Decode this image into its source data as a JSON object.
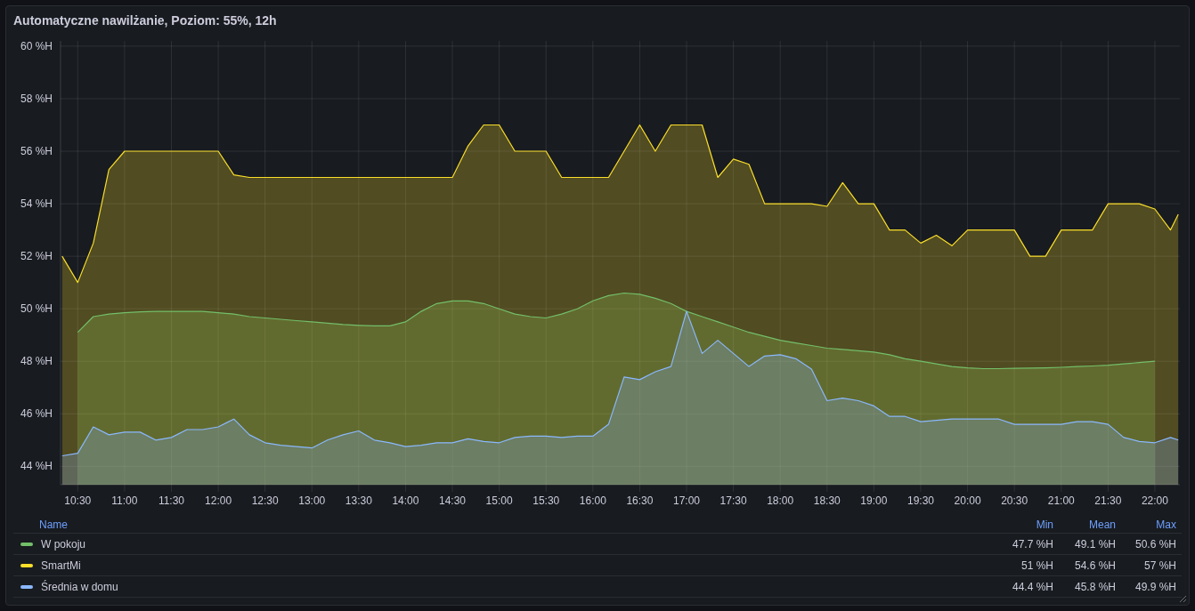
{
  "panel": {
    "title": "Automatyczne nawilżanie, Poziom: 55%, 12h",
    "chart_data": {
      "type": "area",
      "x": [
        620,
        630,
        640,
        650,
        660,
        670,
        680,
        690,
        700,
        710,
        720,
        730,
        740,
        750,
        760,
        770,
        780,
        790,
        800,
        810,
        820,
        830,
        840,
        850,
        860,
        870,
        880,
        890,
        900,
        910,
        920,
        930,
        940,
        950,
        960,
        970,
        980,
        990,
        1000,
        1010,
        1020,
        1030,
        1040,
        1050,
        1060,
        1070,
        1080,
        1090,
        1100,
        1110,
        1120,
        1130,
        1140,
        1150,
        1160,
        1170,
        1180,
        1190,
        1200,
        1210,
        1220,
        1230,
        1240,
        1250,
        1260,
        1270,
        1280,
        1290,
        1300,
        1310,
        1320,
        1330,
        1335
      ],
      "series": [
        {
          "name": "W pokoju",
          "color": "#73bf69",
          "values": [
            null,
            49.1,
            49.7,
            49.8,
            49.85,
            49.88,
            49.9,
            49.9,
            49.9,
            49.9,
            49.85,
            49.8,
            49.7,
            49.65,
            49.6,
            49.55,
            49.5,
            49.45,
            49.4,
            49.37,
            49.35,
            49.35,
            49.5,
            49.9,
            50.2,
            50.3,
            50.3,
            50.2,
            50.0,
            49.8,
            49.7,
            49.65,
            49.8,
            50.0,
            50.3,
            50.5,
            50.6,
            50.55,
            50.4,
            50.2,
            49.9,
            49.7,
            49.5,
            49.3,
            49.1,
            48.95,
            48.8,
            48.7,
            48.6,
            48.5,
            48.45,
            48.4,
            48.35,
            48.25,
            48.1,
            48.0,
            47.9,
            47.8,
            47.75,
            47.72,
            47.72,
            47.73,
            47.74,
            47.75,
            47.77,
            47.8,
            47.82,
            47.85,
            47.9,
            47.95,
            48.0,
            null,
            null
          ]
        },
        {
          "name": "SmartMi",
          "color": "#fade2a",
          "values": [
            52.0,
            51.0,
            52.5,
            55.3,
            56,
            56,
            56,
            56,
            56,
            56,
            56,
            55.1,
            55,
            55,
            55,
            55,
            55,
            55,
            55,
            55,
            55,
            55,
            55,
            55,
            55,
            55,
            56.2,
            57,
            57,
            56,
            56,
            56,
            55,
            55,
            55,
            55,
            56,
            57,
            56,
            57,
            57,
            57,
            55,
            55.7,
            55.5,
            54,
            54,
            54,
            54,
            53.9,
            54.8,
            54,
            54,
            53,
            53,
            52.5,
            52.8,
            52.4,
            53,
            53,
            53,
            53,
            52,
            52,
            53,
            53,
            53,
            54,
            54,
            54,
            53.8,
            53,
            53.6
          ]
        },
        {
          "name": "Średnia w domu",
          "color": "#8ab8ff",
          "values": [
            44.4,
            44.5,
            45.5,
            45.2,
            45.3,
            45.3,
            45.0,
            45.1,
            45.4,
            45.4,
            45.5,
            45.8,
            45.2,
            44.9,
            44.8,
            44.75,
            44.7,
            45.0,
            45.2,
            45.35,
            45.0,
            44.9,
            44.75,
            44.8,
            44.9,
            44.9,
            45.05,
            44.95,
            44.9,
            45.1,
            45.15,
            45.15,
            45.1,
            45.15,
            45.15,
            45.6,
            47.4,
            47.3,
            47.6,
            47.8,
            49.9,
            48.3,
            48.8,
            48.3,
            47.8,
            48.2,
            48.25,
            48.1,
            47.7,
            46.5,
            46.6,
            46.5,
            46.3,
            45.9,
            45.9,
            45.7,
            45.75,
            45.8,
            45.8,
            45.8,
            45.8,
            45.6,
            45.6,
            45.6,
            45.6,
            45.7,
            45.7,
            45.6,
            45.1,
            44.95,
            44.9,
            45.1,
            45.0
          ]
        }
      ],
      "grid": true,
      "xlim": [
        619,
        1336
      ],
      "ylim": [
        43.3,
        60.2
      ],
      "xticks": [
        {
          "value": 630,
          "label": "10:30"
        },
        {
          "value": 660,
          "label": "11:00"
        },
        {
          "value": 690,
          "label": "11:30"
        },
        {
          "value": 720,
          "label": "12:00"
        },
        {
          "value": 750,
          "label": "12:30"
        },
        {
          "value": 780,
          "label": "13:00"
        },
        {
          "value": 810,
          "label": "13:30"
        },
        {
          "value": 840,
          "label": "14:00"
        },
        {
          "value": 870,
          "label": "14:30"
        },
        {
          "value": 900,
          "label": "15:00"
        },
        {
          "value": 930,
          "label": "15:30"
        },
        {
          "value": 960,
          "label": "16:00"
        },
        {
          "value": 990,
          "label": "16:30"
        },
        {
          "value": 1020,
          "label": "17:00"
        },
        {
          "value": 1050,
          "label": "17:30"
        },
        {
          "value": 1080,
          "label": "18:00"
        },
        {
          "value": 1110,
          "label": "18:30"
        },
        {
          "value": 1140,
          "label": "19:00"
        },
        {
          "value": 1170,
          "label": "19:30"
        },
        {
          "value": 1200,
          "label": "20:00"
        },
        {
          "value": 1230,
          "label": "20:30"
        },
        {
          "value": 1260,
          "label": "21:00"
        },
        {
          "value": 1290,
          "label": "21:30"
        },
        {
          "value": 1320,
          "label": "22:00"
        }
      ],
      "yticks": [
        {
          "value": 44,
          "label": "44 %H"
        },
        {
          "value": 46,
          "label": "46 %H"
        },
        {
          "value": 48,
          "label": "48 %H"
        },
        {
          "value": 50,
          "label": "50 %H"
        },
        {
          "value": 52,
          "label": "52 %H"
        },
        {
          "value": 54,
          "label": "54 %H"
        },
        {
          "value": 56,
          "label": "56 %H"
        },
        {
          "value": 58,
          "label": "58 %H"
        },
        {
          "value": 60,
          "label": "60 %H"
        }
      ]
    },
    "legend": {
      "columns": [
        "Name",
        "Min",
        "Mean",
        "Max"
      ],
      "rows": [
        {
          "min": "47.7 %H",
          "mean": "49.1 %H",
          "max": "50.6 %H"
        },
        {
          "min": "51 %H",
          "mean": "54.6 %H",
          "max": "57 %H"
        },
        {
          "min": "44.4 %H",
          "mean": "45.8 %H",
          "max": "49.9 %H"
        }
      ]
    }
  }
}
